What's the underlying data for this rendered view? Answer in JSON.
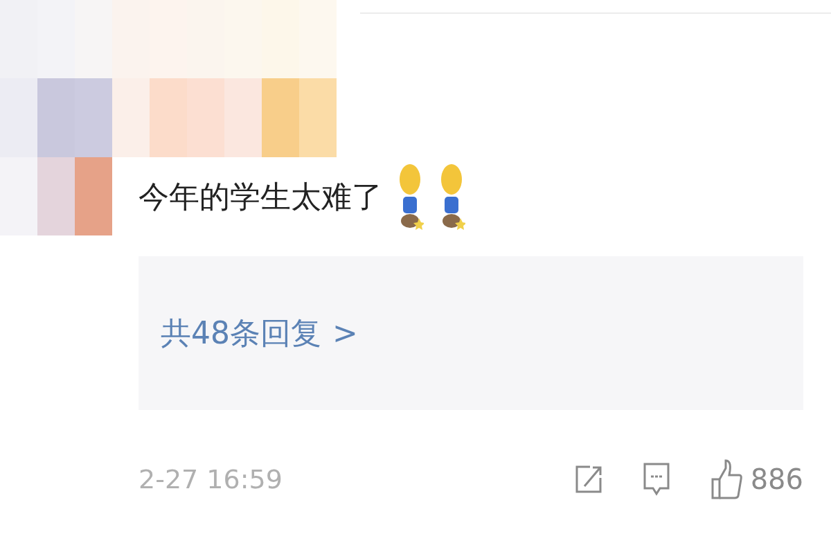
{
  "comment": {
    "text": "今年的学生太难了",
    "emojis": [
      {
        "kind": "figure"
      },
      {
        "kind": "figure"
      }
    ]
  },
  "replies": {
    "label": "共48条回复",
    "chevron": ">"
  },
  "footer": {
    "time": "2-27 16:59",
    "like_count": "886"
  }
}
